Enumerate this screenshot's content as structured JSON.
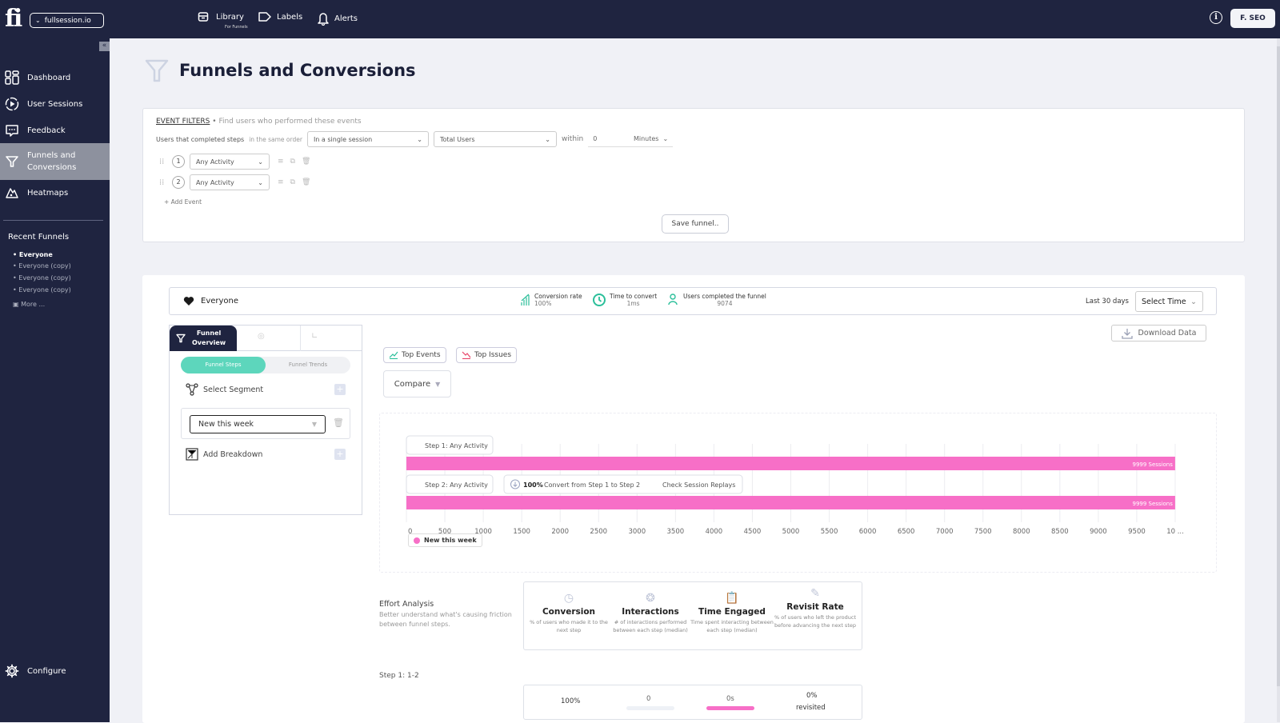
{
  "topbar": {
    "logo": "fi",
    "org": "fullsession.io",
    "nav": [
      {
        "label": "Library",
        "sub": "For Funnels",
        "icon": "archive-icon"
      },
      {
        "label": "Labels",
        "icon": "tag-icon"
      },
      {
        "label": "Alerts",
        "icon": "bell-icon"
      }
    ],
    "user": "F. SEO"
  },
  "sidebar": {
    "items": [
      {
        "label": "Dashboard",
        "icon": "dashboard-icon"
      },
      {
        "label": "User Sessions",
        "icon": "play-icon"
      },
      {
        "label": "Feedback",
        "icon": "chat-icon"
      },
      {
        "label": "Funnels and Conversions",
        "label1": "Funnels and",
        "label2": "Conversions",
        "icon": "funnel-icon",
        "active": true
      },
      {
        "label": "Heatmaps",
        "icon": "heatmap-icon"
      }
    ],
    "recent_title": "Recent Funnels",
    "recent": [
      "Everyone",
      "Everyone (copy)",
      "Everyone (copy)",
      "Everyone (copy)"
    ],
    "more": "More ...",
    "configure": "Configure"
  },
  "page": {
    "title": "Funnels and Conversions"
  },
  "filters": {
    "heading": "EVENT FILTERS",
    "hint": "Find users who performed these events",
    "row_label": "Users that completed steps",
    "order_label": "in the same order",
    "session_select": "In a single session",
    "users_select": "Total Users",
    "within_label": "within",
    "within_value": "0",
    "unit_select": "Minutes",
    "steps": [
      {
        "num": "1",
        "event": "Any Activity"
      },
      {
        "num": "2",
        "event": "Any Activity"
      }
    ],
    "add_event": "+ Add Event",
    "save": "Save funnel.."
  },
  "summary": {
    "name": "Everyone",
    "conversion_label": "Conversion rate",
    "conversion_value": "100%",
    "time_label": "Time to convert",
    "time_value": "1ms",
    "users_label": "Users completed the funnel",
    "users_value": "9074",
    "range": "Last 30 days",
    "select_time": "Select Time"
  },
  "panel": {
    "tab_active_line1": "Funnel",
    "tab_active_line2": "Overview",
    "toggle_on": "Funnel Steps",
    "toggle_off": "Funnel Trends",
    "select_segment": "Select Segment",
    "segment_value": "New this week",
    "add_breakdown": "Add Breakdown"
  },
  "actions": {
    "download": "Download Data",
    "top_events": "Top Events",
    "top_issues": "Top Issues",
    "compare": "Compare"
  },
  "chart_data": {
    "type": "bar",
    "orientation": "horizontal",
    "categories": [
      "Step 1: Any Activity",
      "Step 2: Any Activity"
    ],
    "series": [
      {
        "name": "New this week",
        "color": "#f76fc7",
        "values": [
          9999,
          9999
        ]
      }
    ],
    "bar_labels": [
      "9999 Sessions",
      "9999 Sessions"
    ],
    "conversion_note": {
      "percent": "100%",
      "text": "Convert from Step 1 to Step 2",
      "link": "Check Session Replays"
    },
    "xticks": [
      "0",
      "500",
      "1000",
      "1500",
      "2000",
      "2500",
      "3000",
      "3500",
      "4000",
      "4500",
      "5000",
      "5500",
      "6000",
      "6500",
      "7000",
      "7500",
      "8000",
      "8500",
      "9000",
      "9500",
      "10 ..."
    ],
    "xlim": [
      0,
      10000
    ],
    "grid": true,
    "legend": "bottom-left"
  },
  "effort": {
    "title": "Effort Analysis",
    "subtitle": "Better understand what's causing friction between funnel steps.",
    "columns": [
      {
        "title": "Conversion",
        "desc": "% of users who made it to the next step",
        "icon": "gauge-icon"
      },
      {
        "title": "Interactions",
        "desc": "# of interactions performed between each step (median)",
        "icon": "badge-icon"
      },
      {
        "title": "Time Engaged",
        "desc": "Time spent interacting between each step (median)",
        "icon": "clipboard-clock-icon"
      },
      {
        "title": "Revisit Rate",
        "desc": "% of users who left the product before advancing the next step",
        "icon": "image-edit-icon"
      }
    ],
    "step_label": "Step 1: 1-2",
    "step_values": {
      "conversion": "100%",
      "interactions": "0",
      "time": "0s",
      "revisit": "0%",
      "revisit_sub": "revisited"
    }
  }
}
